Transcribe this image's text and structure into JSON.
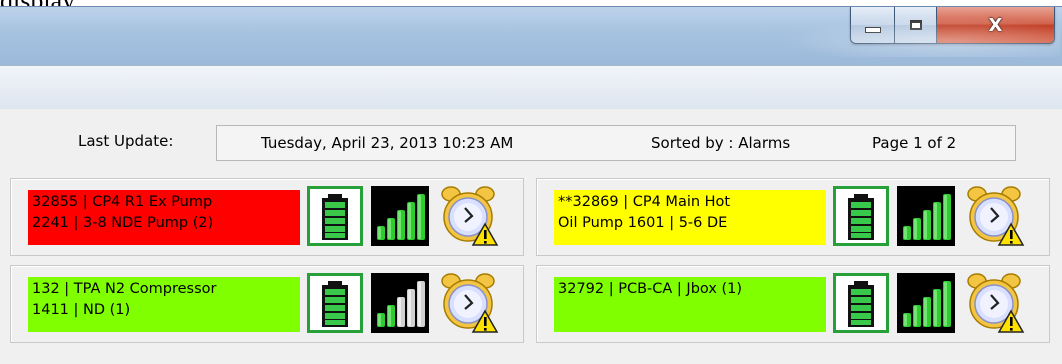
{
  "page_label": "display",
  "window_controls": {
    "minimize_icon": "minimize-icon",
    "maximize_icon": "maximize-icon",
    "close_glyph": "X"
  },
  "status": {
    "last_update_label": "Last Update:",
    "date_text": "Tuesday, April 23, 2013 10:23 AM",
    "sorted_text": "Sorted by : Alarms",
    "page_text": "Page 1 of 2"
  },
  "tiles": [
    {
      "line1": "32855 | CP4 R1 Ex Pump",
      "line2": "2241 | 3-8 NDE Pump (2)",
      "color": "#fe0000",
      "battery_icon": "battery-icon",
      "signal_icon": "signal-strength-icon",
      "signal_bars_green": 5,
      "alarm_icon": "alarm-clock-warning-icon"
    },
    {
      "line1": "**32869 | CP4 Main Hot",
      "line2": "Oil Pump 1601 | 5-6 DE",
      "color": "#ffff00",
      "battery_icon": "battery-icon",
      "signal_icon": "signal-strength-icon",
      "signal_bars_green": 5,
      "alarm_icon": "alarm-clock-warning-icon"
    },
    {
      "line1": "132 | TPA N2 Compressor",
      "line2": "1411 | ND (1)",
      "color": "#80ff00",
      "battery_icon": "battery-icon",
      "signal_icon": "signal-strength-icon",
      "signal_bars_green": 2,
      "alarm_icon": "alarm-clock-warning-icon"
    },
    {
      "line1": "32792 | PCB-CA | Jbox (1)",
      "line2": "",
      "color": "#80ff00",
      "battery_icon": "battery-icon",
      "signal_icon": "signal-strength-icon",
      "signal_bars_green": 5,
      "alarm_icon": "alarm-clock-warning-icon"
    }
  ]
}
